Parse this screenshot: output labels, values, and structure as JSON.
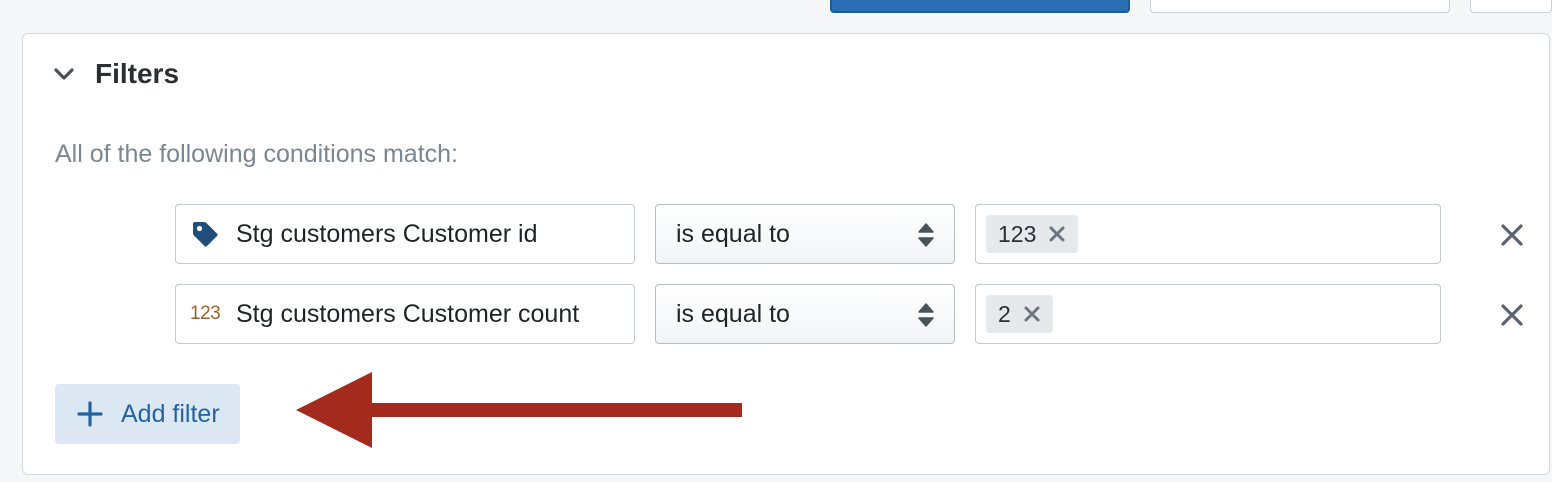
{
  "panel": {
    "title": "Filters",
    "conditions_label": "All of the following conditions match:"
  },
  "filters": [
    {
      "field_icon": "tag-icon",
      "field": "Stg customers Customer id",
      "operator": "is equal to",
      "values": [
        "123"
      ]
    },
    {
      "field_icon": "number-123-icon",
      "field_icon_text": "123",
      "field": "Stg customers Customer count",
      "operator": "is equal to",
      "values": [
        "2"
      ]
    }
  ],
  "add_filter": {
    "label": "Add filter"
  },
  "colors": {
    "primary": "#2a6fb5",
    "add_filter_bg": "#dce8f3",
    "add_filter_text": "#2463a3",
    "annotation_arrow": "#a52a1e",
    "tag_icon": "#1f4e7a",
    "number_icon": "#a0622d"
  }
}
